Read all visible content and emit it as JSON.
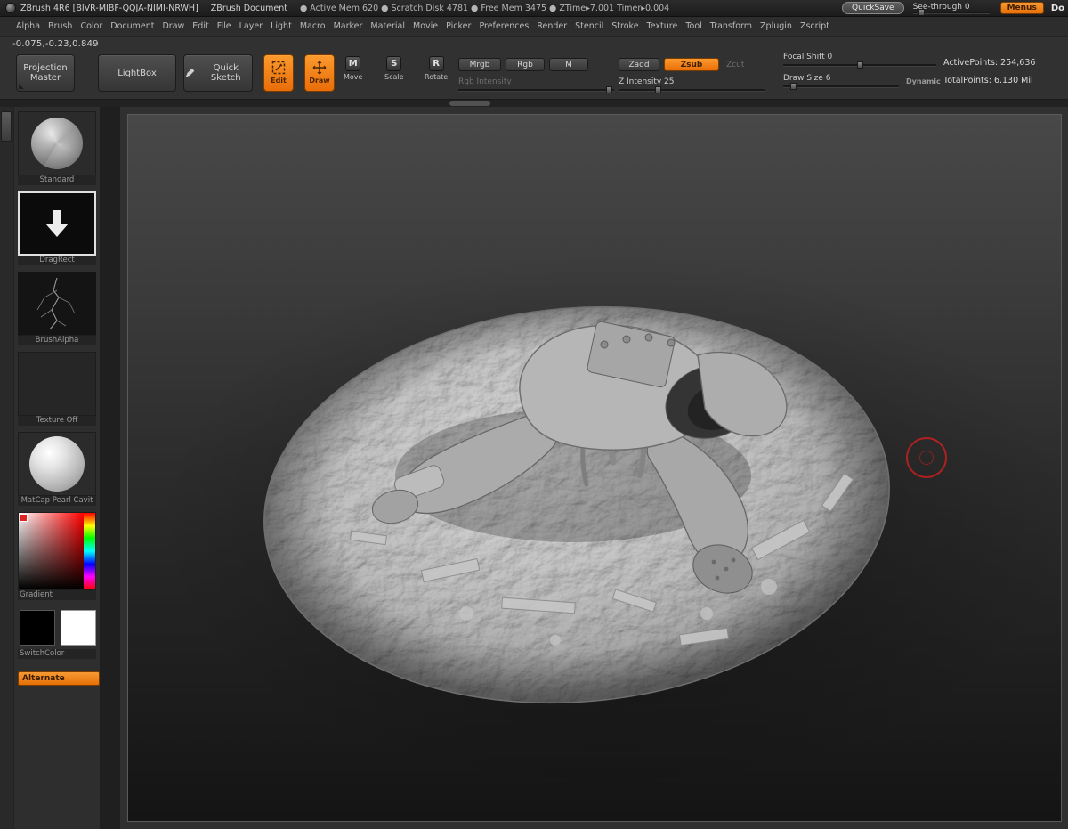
{
  "colors": {
    "accent_orange": "#f07d12",
    "cursor_red": "#c42020"
  },
  "titlebar": {
    "app_title": "ZBrush 4R6 [BIVR-MIBF-QQJA-NIMI-NRWH]",
    "doc_title": "ZBrush Document",
    "stats": "● Active Mem 620  ● Scratch Disk 4781  ● Free Mem 3475  ● ZTime▸7.001  Timer▸0.004",
    "quicksave_label": "QuickSave",
    "see_through_label": "See-through 0",
    "menus_label": "Menus",
    "clipped_label": "Do"
  },
  "menubar": {
    "items": [
      "Alpha",
      "Brush",
      "Color",
      "Document",
      "Draw",
      "Edit",
      "File",
      "Layer",
      "Light",
      "Macro",
      "Marker",
      "Material",
      "Movie",
      "Picker",
      "Preferences",
      "Render",
      "Stencil",
      "Stroke",
      "Texture",
      "Tool",
      "Transform",
      "Zplugin",
      "Zscript"
    ]
  },
  "coords_readout": "-0.075,-0.23,0.849",
  "toolbar": {
    "projection_master_label": "Projection Master",
    "lightbox_label": "LightBox",
    "quick_sketch_label": "Quick Sketch",
    "edit_label": "Edit",
    "draw_label": "Draw",
    "move_label": "Move",
    "scale_label": "Scale",
    "rotate_label": "Rotate",
    "move_glyph": "M",
    "scale_glyph": "S",
    "rotate_glyph": "R",
    "mrgb_label": "Mrgb",
    "rgb_label": "Rgb",
    "m_label": "M",
    "rgb_intensity_label": "Rgb Intensity",
    "zadd_label": "Zadd",
    "zsub_label": "Zsub",
    "zcut_label": "Zcut",
    "z_intensity_label": "Z Intensity 25",
    "focal_shift_label": "Focal Shift 0",
    "draw_size_label": "Draw Size 6",
    "dynamic_label": "Dynamic",
    "active_points": "ActivePoints: 254,636",
    "total_points": "TotalPoints: 6.130 Mil"
  },
  "sidebar": {
    "brush_label": "Standard",
    "stroke_label": "DragRect",
    "alpha_label": "BrushAlpha",
    "texture_label": "Texture Off",
    "material_label": "MatCap Pearl Cavit",
    "gradient_label": "Gradient",
    "switch_color_label": "SwitchColor",
    "alternate_label": "Alternate"
  }
}
